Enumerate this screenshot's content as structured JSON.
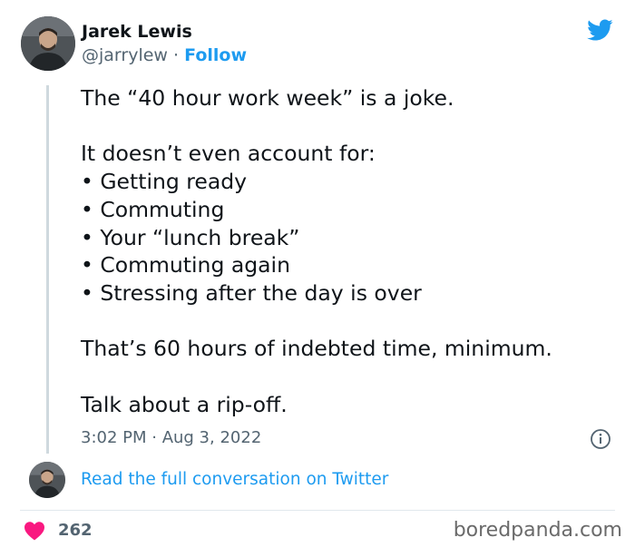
{
  "tweet": {
    "author_name": "Jarek Lewis",
    "handle": "@jarrylew",
    "separator": "·",
    "follow_label": "Follow",
    "lines": {
      "l1": "The “40 hour work week” is a joke.",
      "l2": "It doesn’t even account for:",
      "b1": "Getting ready",
      "b2": "Commuting",
      "b3": "Your “lunch break”",
      "b4": "Commuting again",
      "b5": "Stressing after the day is over",
      "l3": "That’s 60 hours of indebted time, minimum.",
      "l4": "Talk about a rip-off."
    },
    "timestamp": "3:02 PM · Aug 3, 2022",
    "read_conversation": "Read the full conversation on Twitter",
    "like_count": "262"
  },
  "watermark": "boredpanda.com",
  "icons": {
    "brand": "twitter-bird-icon",
    "info": "info-icon",
    "like": "heart-icon"
  },
  "colors": {
    "twitter_blue": "#1d9bf0",
    "text_primary": "#0f1419",
    "text_secondary": "#536471",
    "heart": "#f91880"
  }
}
